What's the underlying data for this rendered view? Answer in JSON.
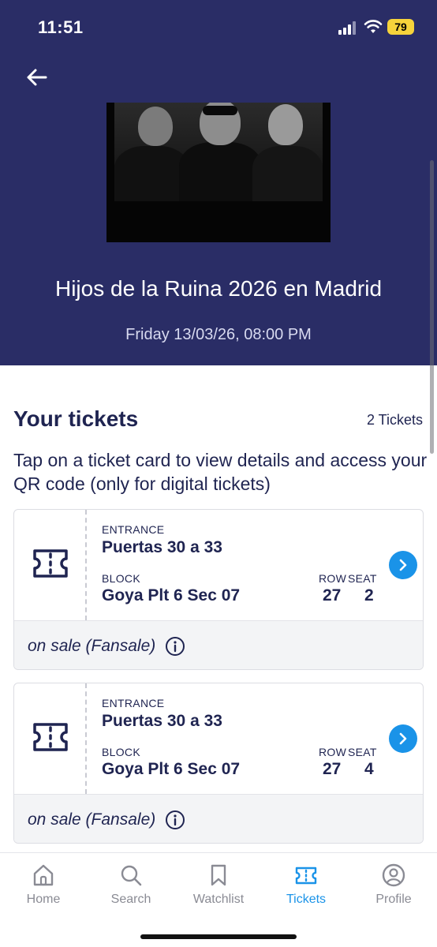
{
  "status_bar": {
    "time": "11:51",
    "battery": "79"
  },
  "event": {
    "title": "Hijos de la Ruina 2026 en Madrid",
    "date": "Friday 13/03/26, 08:00 PM"
  },
  "tickets_section": {
    "title": "Your tickets",
    "count": "2 Tickets",
    "instructions": "Tap on a ticket card to view details and access your QR code (only for digital tickets)"
  },
  "tickets": [
    {
      "entrance_label": "ENTRANCE",
      "entrance": "Puertas 30 a 33",
      "block_label": "BLOCK",
      "block": "Goya Plt 6 Sec 07",
      "row_label": "ROW",
      "row": "27",
      "seat_label": "SEAT",
      "seat": "2",
      "status": "on sale (Fansale)"
    },
    {
      "entrance_label": "ENTRANCE",
      "entrance": "Puertas 30 a 33",
      "block_label": "BLOCK",
      "block": "Goya Plt 6 Sec 07",
      "row_label": "ROW",
      "row": "27",
      "seat_label": "SEAT",
      "seat": "4",
      "status": "on sale (Fansale)"
    }
  ],
  "tab_bar": {
    "items": [
      {
        "label": "Home",
        "icon": "home-icon",
        "active": false
      },
      {
        "label": "Search",
        "icon": "search-icon",
        "active": false
      },
      {
        "label": "Watchlist",
        "icon": "bookmark-icon",
        "active": false
      },
      {
        "label": "Tickets",
        "icon": "ticket-icon",
        "active": true
      },
      {
        "label": "Profile",
        "icon": "profile-icon",
        "active": false
      }
    ]
  },
  "colors": {
    "header_bg": "#2a2d66",
    "primary_text": "#1f2451",
    "accent": "#1a93e8",
    "battery": "#f6d33b"
  }
}
